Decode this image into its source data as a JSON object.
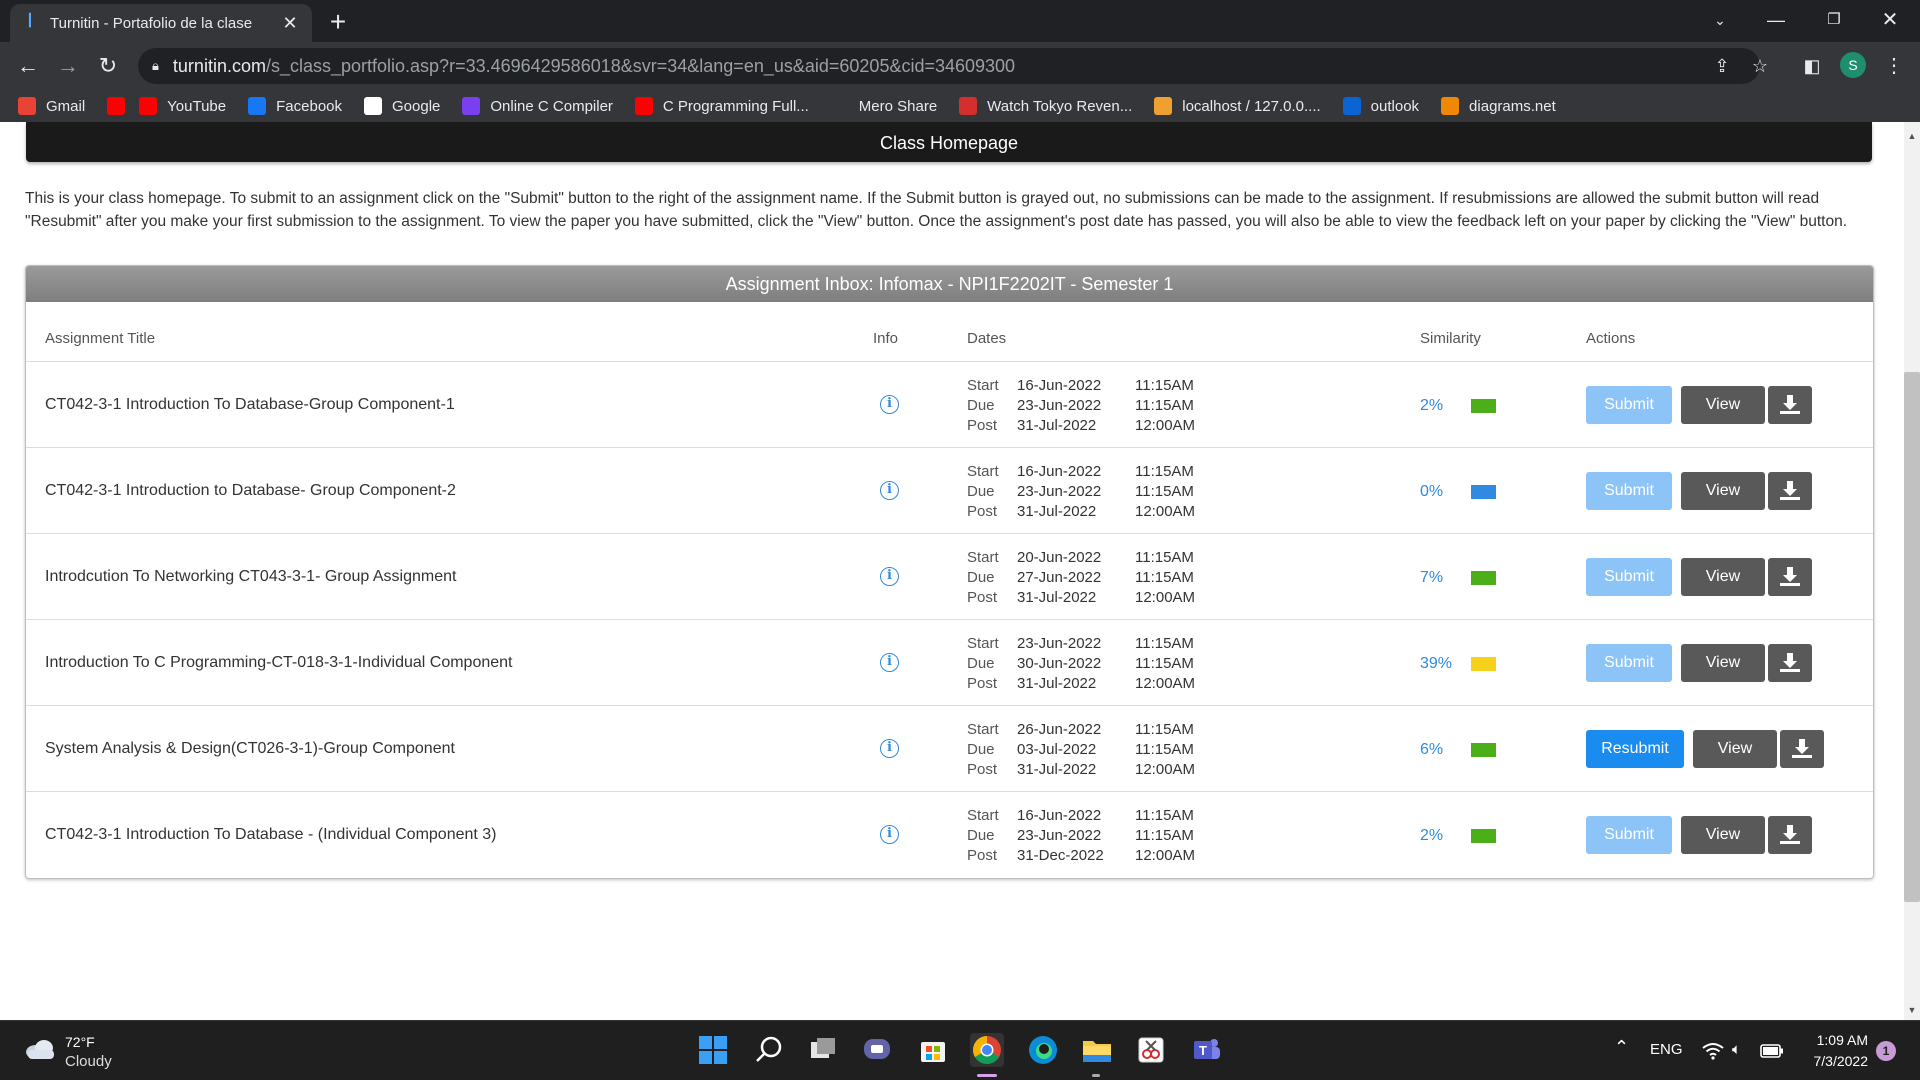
{
  "browser": {
    "tab_title": "Turnitin - Portafolio de la clase",
    "url_host": "turnitin.com",
    "url_path": "/s_class_portfolio.asp?r=33.4696429586018&svr=34&lang=en_us&aid=60205&cid=34609300",
    "profile_initial": "S",
    "bookmarks": [
      {
        "label": "Gmail",
        "icon": "gmail-icon",
        "color": "#ea4335"
      },
      {
        "label": "",
        "icon": "youtube-icon",
        "color": "#ff0000"
      },
      {
        "label": "YouTube",
        "icon": "youtube-icon",
        "color": "#ff0000"
      },
      {
        "label": "Facebook",
        "icon": "facebook-icon",
        "color": "#1877f2"
      },
      {
        "label": "Google",
        "icon": "google-icon",
        "color": "#ffffff"
      },
      {
        "label": "Online C Compiler",
        "icon": "compiler-icon",
        "color": "#7b3ff2"
      },
      {
        "label": "C Programming Full...",
        "icon": "youtube-icon",
        "color": "#ff0000"
      },
      {
        "label": "Mero Share",
        "icon": "meroshare-icon",
        "color": "#35363a"
      },
      {
        "label": "Watch Tokyo Reven...",
        "icon": "anime-icon",
        "color": "#d32f2f"
      },
      {
        "label": "localhost / 127.0.0....",
        "icon": "phpmyadmin-icon",
        "color": "#f0a030"
      },
      {
        "label": "outlook",
        "icon": "outlook-icon",
        "color": "#0a64d2"
      },
      {
        "label": "diagrams.net",
        "icon": "diagrams-icon",
        "color": "#f08705"
      }
    ]
  },
  "page": {
    "class_header": "Class Homepage",
    "intro": "This is your class homepage. To submit to an assignment click on the \"Submit\" button to the right of the assignment name. If the Submit button is grayed out, no submissions can be made to the assignment. If resubmissions are allowed the submit button will read \"Resubmit\" after you make your first submission to the assignment. To view the paper you have submitted, click the \"View\" button. Once the assignment's post date has passed, you will also be able to view the feedback left on your paper by clicking the \"View\" button.",
    "inbox_title": "Assignment Inbox: Infomax - NPI1F2202IT - Semester 1",
    "columns": {
      "title": "Assignment Title",
      "info": "Info",
      "dates": "Dates",
      "similarity": "Similarity",
      "actions": "Actions"
    },
    "date_labels": {
      "start": "Start",
      "due": "Due",
      "post": "Post"
    },
    "view_label": "View",
    "assignments": [
      {
        "title": "CT042-3-1 Introduction To Database-Group Component-1",
        "start_date": "16-Jun-2022",
        "start_time": "11:15AM",
        "due_date": "23-Jun-2022",
        "due_time": "11:15AM",
        "post_date": "31-Jul-2022",
        "post_time": "12:00AM",
        "similarity": "2%",
        "similarity_color": "#4caf1a",
        "action_label": "Submit",
        "action_enabled": false
      },
      {
        "title": "CT042-3-1 Introduction to Database- Group Component-2",
        "start_date": "16-Jun-2022",
        "start_time": "11:15AM",
        "due_date": "23-Jun-2022",
        "due_time": "11:15AM",
        "post_date": "31-Jul-2022",
        "post_time": "12:00AM",
        "similarity": "0%",
        "similarity_color": "#2f8ae0",
        "action_label": "Submit",
        "action_enabled": false
      },
      {
        "title": "Introdcution To Networking CT043-3-1- Group Assignment",
        "start_date": "20-Jun-2022",
        "start_time": "11:15AM",
        "due_date": "27-Jun-2022",
        "due_time": "11:15AM",
        "post_date": "31-Jul-2022",
        "post_time": "12:00AM",
        "similarity": "7%",
        "similarity_color": "#4caf1a",
        "action_label": "Submit",
        "action_enabled": false
      },
      {
        "title": "Introduction To C Programming-CT-018-3-1-Individual Component",
        "start_date": "23-Jun-2022",
        "start_time": "11:15AM",
        "due_date": "30-Jun-2022",
        "due_time": "11:15AM",
        "post_date": "31-Jul-2022",
        "post_time": "12:00AM",
        "similarity": "39%",
        "similarity_color": "#f5d11c",
        "action_label": "Submit",
        "action_enabled": false
      },
      {
        "title": "System Analysis & Design(CT026-3-1)-Group Component",
        "start_date": "26-Jun-2022",
        "start_time": "11:15AM",
        "due_date": "03-Jul-2022",
        "due_time": "11:15AM",
        "post_date": "31-Jul-2022",
        "post_time": "12:00AM",
        "similarity": "6%",
        "similarity_color": "#4caf1a",
        "action_label": "Resubmit",
        "action_enabled": true
      },
      {
        "title": "CT042-3-1 Introduction To Database - (Individual Component 3)",
        "start_date": "16-Jun-2022",
        "start_time": "11:15AM",
        "due_date": "23-Jun-2022",
        "due_time": "11:15AM",
        "post_date": "31-Dec-2022",
        "post_time": "12:00AM",
        "similarity": "2%",
        "similarity_color": "#4caf1a",
        "action_label": "Submit",
        "action_enabled": false
      }
    ]
  },
  "taskbar": {
    "weather_temp": "72°F",
    "weather_condition": "Cloudy",
    "language": "ENG",
    "time": "1:09 AM",
    "date": "7/3/2022",
    "notification_count": "1"
  }
}
